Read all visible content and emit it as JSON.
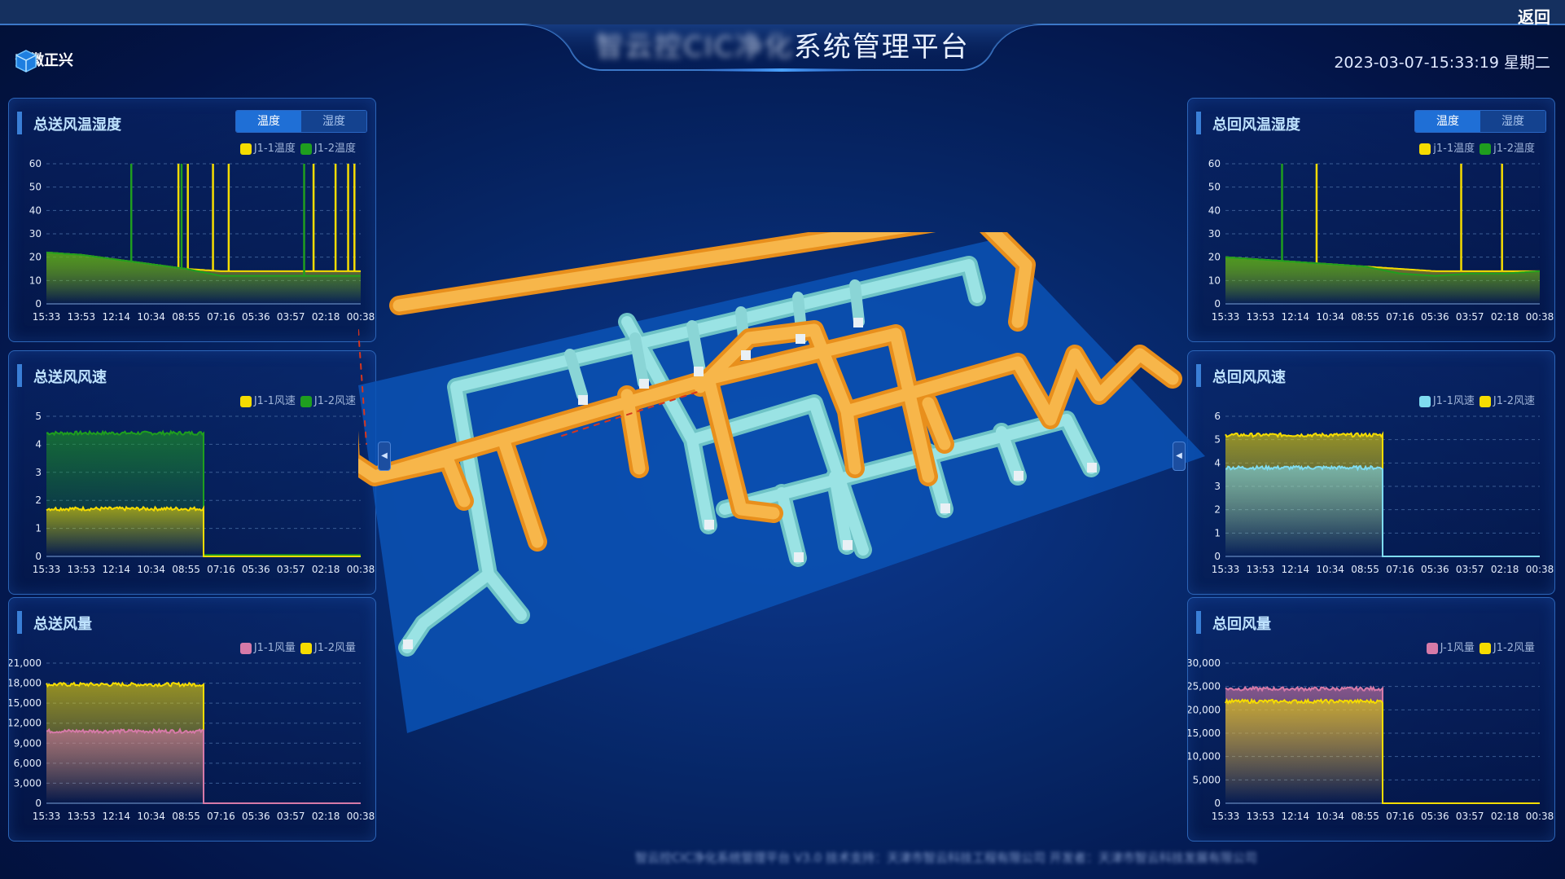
{
  "header": {
    "title_blurred": "智云控CIC净化",
    "title_main": "系统管理平台",
    "back_label": "返回",
    "company": "安徽正兴",
    "datetime": "2023-03-07-15:33:19 星期二"
  },
  "footer": {
    "text": "智云控CIC净化系统管理平台 V3.0 技术支持：天津市智云科技工程有限公司 开发者：天津市智云科技发展有限公司"
  },
  "colors": {
    "yellow": "#f5dc00",
    "green": "#1f9e1f",
    "cyan": "#7fdcf0",
    "pink": "#d67aa8",
    "orange": "#f5a530",
    "duct_cyan": "#8ad5d6",
    "floor": "#0a52b5"
  },
  "toggle": {
    "temp": "温度",
    "humidity": "湿度"
  },
  "x_ticks": [
    "15:33",
    "13:53",
    "12:14",
    "10:34",
    "08:55",
    "07:16",
    "05:36",
    "03:57",
    "02:18",
    "00:38"
  ],
  "panels": {
    "supply_temp": {
      "title": "总送风温湿度",
      "legend": [
        {
          "label": "J1-1温度",
          "color": "#f5dc00"
        },
        {
          "label": "J1-2温度",
          "color": "#1f9e1f"
        }
      ]
    },
    "supply_speed": {
      "title": "总送风风速",
      "legend": [
        {
          "label": "J1-1风速",
          "color": "#f5dc00"
        },
        {
          "label": "J1-2风速",
          "color": "#1f9e1f"
        }
      ]
    },
    "supply_volume": {
      "title": "总送风量",
      "legend": [
        {
          "label": "J1-1风量",
          "color": "#d67aa8"
        },
        {
          "label": "J1-2风量",
          "color": "#f5dc00"
        }
      ]
    },
    "return_temp": {
      "title": "总回风温湿度",
      "legend": [
        {
          "label": "j1-1温度",
          "color": "#f5dc00"
        },
        {
          "label": "j1-2温度",
          "color": "#1f9e1f"
        }
      ]
    },
    "return_speed": {
      "title": "总回风风速",
      "legend": [
        {
          "label": "J1-1风速",
          "color": "#7fdcf0"
        },
        {
          "label": "J1-2风速",
          "color": "#f5dc00"
        }
      ]
    },
    "return_volume": {
      "title": "总回风量",
      "legend": [
        {
          "label": "J-1风量",
          "color": "#d67aa8"
        },
        {
          "label": "J1-2风量",
          "color": "#f5dc00"
        }
      ]
    }
  },
  "chart_data": [
    {
      "id": "supply_temp",
      "type": "line",
      "ylim": [
        0,
        60
      ],
      "yticks": [
        "0",
        "10",
        "20",
        "30",
        "40",
        "50",
        "60"
      ],
      "series": [
        {
          "name": "J1-1温度",
          "color": "#f5dc00",
          "base": [
            22,
            21,
            19,
            17,
            15,
            14,
            14,
            14,
            14,
            14
          ],
          "spikes": [
            [
              0.42,
              60
            ],
            [
              0.45,
              60
            ],
            [
              0.53,
              60
            ],
            [
              0.58,
              60
            ],
            [
              0.85,
              60
            ],
            [
              0.92,
              60
            ],
            [
              0.96,
              60
            ],
            [
              0.98,
              60
            ]
          ],
          "end": 1.0
        },
        {
          "name": "J1-2温度",
          "color": "#1f9e1f",
          "base": [
            22,
            21,
            19,
            17,
            15,
            12,
            12,
            12,
            12,
            12
          ],
          "spikes": [
            [
              0.27,
              60
            ],
            [
              0.43,
              60
            ],
            [
              0.82,
              60
            ]
          ],
          "end": 1.0
        }
      ]
    },
    {
      "id": "supply_speed",
      "type": "area",
      "ylim": [
        0,
        5
      ],
      "yticks": [
        "0",
        "1",
        "2",
        "3",
        "4",
        "5"
      ],
      "series": [
        {
          "name": "J1-2风速",
          "color": "#1f9e1f",
          "level": 4.4,
          "after": 0.05,
          "cut": 0.5
        },
        {
          "name": "J1-1风速",
          "color": "#f5dc00",
          "level": 1.7,
          "after": 0,
          "cut": 0.5
        }
      ]
    },
    {
      "id": "supply_volume",
      "type": "area",
      "ylim": [
        0,
        21000
      ],
      "yticks": [
        "0",
        "3,000",
        "6,000",
        "9,000",
        "12,000",
        "15,000",
        "18,000",
        "21,000"
      ],
      "series": [
        {
          "name": "J1-2风量",
          "color": "#f5dc00",
          "level": 17800,
          "after": 0,
          "cut": 0.5
        },
        {
          "name": "J1-1风量",
          "color": "#d67aa8",
          "level": 10800,
          "after": 0,
          "cut": 0.5
        }
      ]
    },
    {
      "id": "return_temp",
      "type": "line",
      "ylim": [
        0,
        60
      ],
      "yticks": [
        "0",
        "10",
        "20",
        "30",
        "40",
        "50",
        "60"
      ],
      "series": [
        {
          "name": "j1-1温度",
          "color": "#f5dc00",
          "base": [
            20,
            19,
            18,
            17,
            16,
            15,
            14,
            14,
            14,
            14
          ],
          "spikes": [
            [
              0.29,
              60
            ],
            [
              0.75,
              60
            ],
            [
              0.88,
              60
            ]
          ],
          "end": 1.0
        },
        {
          "name": "j1-2温度",
          "color": "#1f9e1f",
          "base": [
            20,
            19,
            18,
            17,
            16,
            13,
            12,
            13,
            13,
            14
          ],
          "spikes": [
            [
              0.18,
              60
            ]
          ],
          "end": 1.0
        }
      ]
    },
    {
      "id": "return_speed",
      "type": "area",
      "ylim": [
        0,
        6
      ],
      "yticks": [
        "0",
        "1",
        "2",
        "3",
        "4",
        "5",
        "6"
      ],
      "series": [
        {
          "name": "J1-2风速",
          "color": "#f5dc00",
          "level": 5.2,
          "after": 0,
          "cut": 0.5
        },
        {
          "name": "J1-1风速",
          "color": "#7fdcf0",
          "level": 3.8,
          "after": 0,
          "cut": 0.5
        }
      ]
    },
    {
      "id": "return_volume",
      "type": "area",
      "ylim": [
        0,
        30000
      ],
      "yticks": [
        "0",
        "5,000",
        "10,000",
        "15,000",
        "20,000",
        "25,000",
        "30,000"
      ],
      "series": [
        {
          "name": "J-1风量",
          "color": "#d67aa8",
          "level": 24500,
          "after": 0,
          "cut": 0.5
        },
        {
          "name": "J1-2风量",
          "color": "#f5dc00",
          "level": 21800,
          "after": 0,
          "cut": 0.5
        }
      ]
    }
  ]
}
